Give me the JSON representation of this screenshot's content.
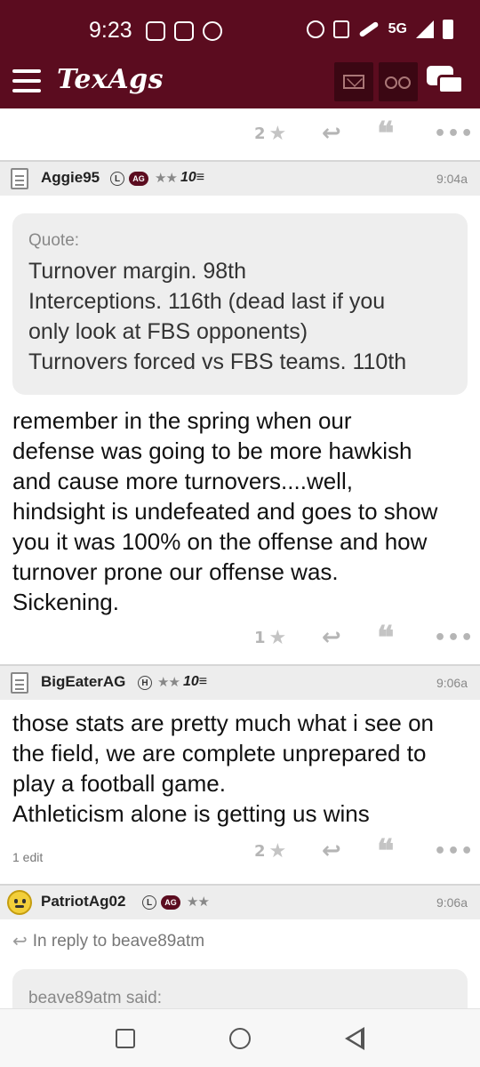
{
  "status_bar": {
    "time": "9:23",
    "network": "5G"
  },
  "app_bar": {
    "logo": "TexAgs"
  },
  "posts": [
    {
      "like_count": "2"
    },
    {
      "username": "Aggie95",
      "badge_level": "L",
      "badge_ag": "AG",
      "stars": "★★",
      "rank": "10≡",
      "time": "9:04a",
      "quote_label": "Quote:",
      "quote_lines": [
        "Turnover margin. 98th",
        "Interceptions. 116th (dead last if you",
        "only look at FBS opponents)",
        "Turnovers forced vs FBS teams. 110th"
      ],
      "body_lines": [
        "remember in the spring when our",
        "defense was going to be more hawkish",
        "and cause more turnovers....well,",
        "hindsight is undefeated and goes to show",
        "you it was 100% on the offense and how",
        "turnover prone our offense was.",
        "Sickening."
      ],
      "like_count": "1"
    },
    {
      "username": "BigEaterAG",
      "badge_level": "H",
      "stars": "★★",
      "rank": "10≡",
      "time": "9:06a",
      "body_lines": [
        "those stats are pretty much what i see on",
        "the field, we are complete unprepared to",
        "play a football game.",
        "Athleticism alone is getting us wins"
      ],
      "edit_label": "1 edit",
      "like_count": "2"
    },
    {
      "username": "PatriotAg02",
      "badge_level": "L",
      "badge_ag": "AG",
      "stars": "★★",
      "time": "9:06a",
      "reply_to": "In reply to beave89atm",
      "quote_label": "beave89atm said:"
    }
  ],
  "colors": {
    "maroon": "#5b0c1f",
    "gray_bg": "#ededed"
  }
}
